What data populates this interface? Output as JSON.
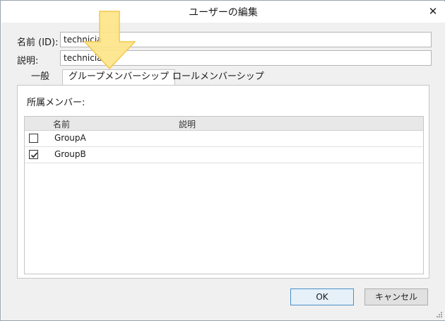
{
  "window": {
    "title": "ユーザーの編集",
    "close_glyph": "✕"
  },
  "fields": {
    "name_label": "名前 (ID):",
    "name_value": "technicia",
    "description_label": "説明:",
    "description_value": "technicia"
  },
  "tabs": [
    {
      "label": "一般",
      "active": false
    },
    {
      "label": "グループメンバーシップ",
      "active": true
    },
    {
      "label": "ロールメンバーシップ",
      "active": false
    }
  ],
  "panel": {
    "members_label": "所属メンバー:",
    "columns": {
      "name": "名前",
      "description": "説明"
    },
    "rows": [
      {
        "name": "GroupA",
        "description": "",
        "checked": false
      },
      {
        "name": "GroupB",
        "description": "",
        "checked": true
      }
    ]
  },
  "buttons": {
    "ok": "OK",
    "cancel": "キャンセル"
  },
  "colors": {
    "arrow_fill": "#fde58a",
    "arrow_stroke": "#f3c74b",
    "ok_border": "#4a90c8"
  },
  "icons": {
    "close": "close-icon",
    "arrow": "down-arrow-icon",
    "check": "check-icon",
    "grip": "resize-grip-icon"
  }
}
